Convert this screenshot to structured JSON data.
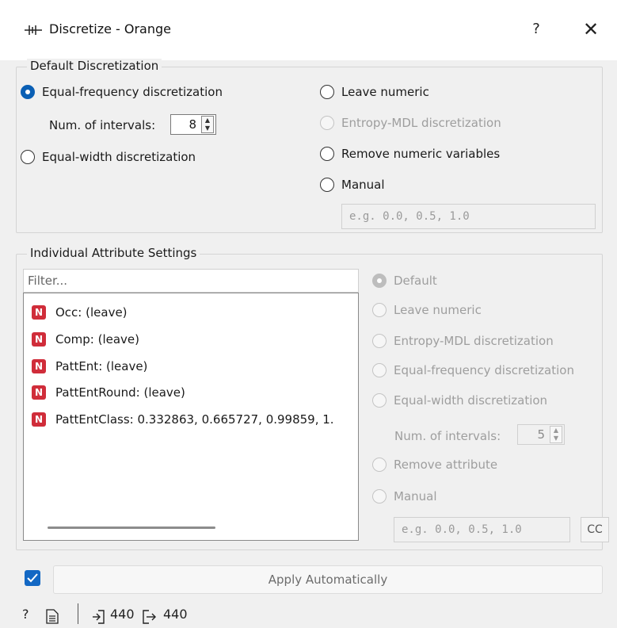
{
  "window": {
    "title": "Discretize - Orange",
    "help_label": "?",
    "close_label": "✕"
  },
  "default_discretization": {
    "group_title": "Default Discretization",
    "options": {
      "equal_frequency": "Equal-frequency discretization",
      "equal_width": "Equal-width discretization",
      "leave_numeric": "Leave numeric",
      "entropy_mdl": "Entropy-MDL discretization",
      "remove_numeric": "Remove numeric variables",
      "manual": "Manual"
    },
    "selected": "Equal-frequency discretization",
    "num_intervals_label": "Num. of intervals:",
    "num_intervals_value": "8",
    "manual_placeholder": "e.g. 0.0, 0.5, 1.0"
  },
  "individual_settings": {
    "group_title": "Individual Attribute Settings",
    "filter_placeholder": "Filter...",
    "attributes": [
      {
        "badge": "N",
        "label": "Occ:  (leave)"
      },
      {
        "badge": "N",
        "label": "Comp:  (leave)"
      },
      {
        "badge": "N",
        "label": "PattEnt:  (leave)"
      },
      {
        "badge": "N",
        "label": "PattEntRound:  (leave)"
      },
      {
        "badge": "N",
        "label": "PattEntClass: 0.332863, 0.665727, 0.99859, 1."
      }
    ],
    "options": {
      "default": "Default",
      "leave_numeric": "Leave numeric",
      "entropy_mdl": "Entropy-MDL discretization",
      "equal_frequency": "Equal-frequency discretization",
      "equal_width": "Equal-width discretization",
      "remove_attribute": "Remove attribute",
      "manual": "Manual"
    },
    "selected": "Default",
    "num_intervals_label": "Num. of intervals:",
    "num_intervals_value": "5",
    "manual_placeholder": "e.g. 0.0, 0.5, 1.0",
    "cc_label": "CC"
  },
  "footer": {
    "apply_automatically_checked": true,
    "apply_label": "Apply Automatically",
    "help_icon": "?",
    "input_count": "440",
    "output_count": "440"
  },
  "colors": {
    "accent": "#0a5fb4",
    "numeric_badge": "#d02d3a"
  }
}
